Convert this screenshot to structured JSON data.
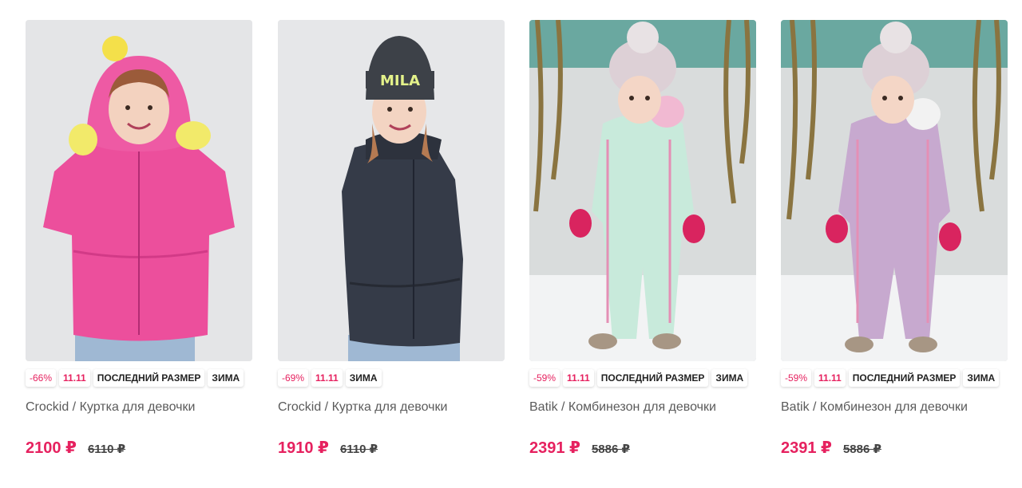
{
  "products": [
    {
      "brand_title": "Crockid / Куртка для девочки",
      "price": "2100 ₽",
      "old_price": "6110 ₽",
      "badges": [
        "-66%",
        "11.11",
        "ПОСЛЕДНИЙ РАЗМЕР",
        "ЗИМА"
      ],
      "jacket_color": "#ec4f9c",
      "photo_icon": "girl-pink-jacket-photo"
    },
    {
      "brand_title": "Crockid / Куртка для девочки",
      "price": "1910 ₽",
      "old_price": "6110 ₽",
      "badges": [
        "-69%",
        "11.11",
        "ЗИМА"
      ],
      "jacket_color": "#353b48",
      "photo_icon": "girl-dark-jacket-photo"
    },
    {
      "brand_title": "Batik / Комбинезон для девочки",
      "price": "2391 ₽",
      "old_price": "5886 ₽",
      "badges": [
        "-59%",
        "11.11",
        "ПОСЛЕДНИЙ РАЗМЕР",
        "ЗИМА"
      ],
      "jacket_color": "#c8eadb",
      "photo_icon": "toddler-mint-overall-photo"
    },
    {
      "brand_title": "Batik / Комбинезон для девочки",
      "price": "2391 ₽",
      "old_price": "5886 ₽",
      "badges": [
        "-59%",
        "11.11",
        "ПОСЛЕДНИЙ РАЗМЕР",
        "ЗИМА"
      ],
      "jacket_color": "#c7a9cf",
      "photo_icon": "toddler-lilac-overall-photo"
    }
  ],
  "colors": {
    "accent": "#e6215f",
    "title_text": "#5b5b5b"
  }
}
